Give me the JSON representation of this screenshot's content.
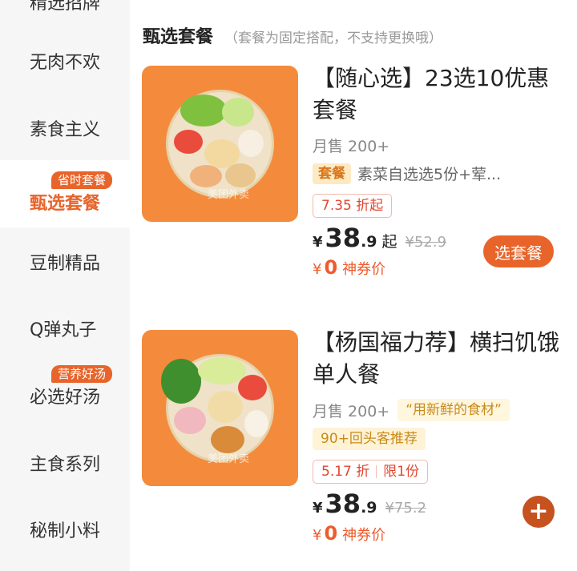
{
  "sidebar": {
    "items": [
      {
        "label": "精选招牌",
        "badge": ""
      },
      {
        "label": "无肉不欢",
        "badge": ""
      },
      {
        "label": "素食主义",
        "badge": ""
      },
      {
        "label": "甄选套餐",
        "badge": "省时套餐"
      },
      {
        "label": "豆制精品",
        "badge": ""
      },
      {
        "label": "Q弹丸子",
        "badge": ""
      },
      {
        "label": "必选好汤",
        "badge": "营养好汤"
      },
      {
        "label": "主食系列",
        "badge": ""
      },
      {
        "label": "秘制小料",
        "badge": ""
      }
    ]
  },
  "section": {
    "title": "甄选套餐",
    "note": "（套餐为固定搭配，不支持更换哦）"
  },
  "products": [
    {
      "title": "【随心选】23选10优惠套餐",
      "sold": "月售 200+",
      "meal_badge": "套餐",
      "meal_desc": "素菜自选选5份+荤...",
      "discount": "7.35 折起",
      "price_currency": "¥",
      "price_int": "38",
      "price_dec": ".9",
      "price_suffix": "起",
      "original_price": "¥52.9",
      "coupon_currency": "¥",
      "coupon_value": "0",
      "coupon_text": "神券价",
      "action": "选套餐",
      "watermark": "美团外卖"
    },
    {
      "title": "【杨国福力荐】横扫饥饿单人餐",
      "sold": "月售 200+",
      "quote_tag": "“用新鲜的食材”",
      "repeat_tag": "90+回头客推荐",
      "discount": "5.17 折",
      "limit": "限1份",
      "price_currency": "¥",
      "price_int": "38",
      "price_dec": ".9",
      "original_price": "¥75.2",
      "coupon_currency": "¥",
      "coupon_value": "0",
      "coupon_text": "神券价",
      "action_icon": "plus-icon",
      "watermark": "美团外卖"
    }
  ],
  "colors": {
    "accent": "#e8642a",
    "discount_red": "#e2452f",
    "image_bg": "#f48b3c"
  }
}
